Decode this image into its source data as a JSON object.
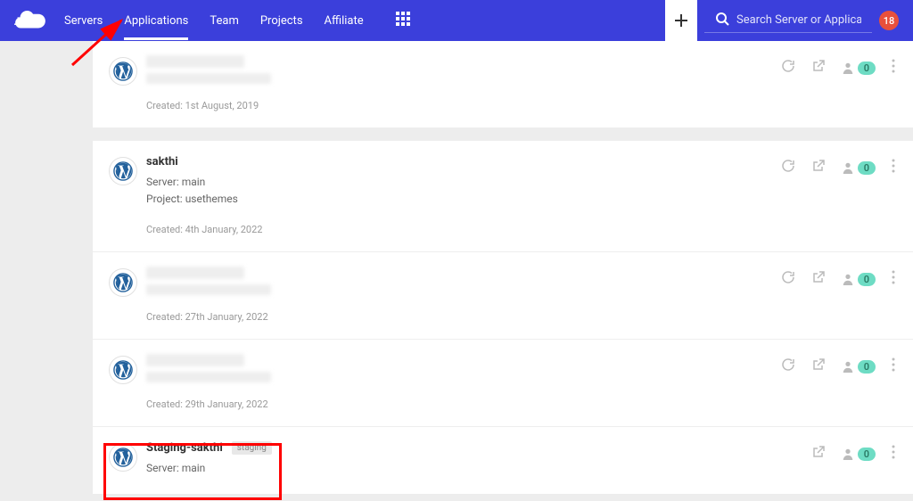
{
  "header": {
    "nav": {
      "servers": "Servers",
      "applications": "Applications",
      "team": "Team",
      "projects": "Projects",
      "affiliate": "Affiliate"
    },
    "search": {
      "placeholder": "Search Server or Application"
    },
    "notifications_count": "18"
  },
  "apps": [
    {
      "title": "",
      "blurred": true,
      "created": "Created: 1st August, 2019",
      "badge": "0"
    },
    {
      "title": "sakthi",
      "server": "Server: main",
      "project": "Project: usethemes",
      "created": "Created: 4th January, 2022",
      "badge": "0"
    },
    {
      "title": "",
      "blurred": true,
      "created": "Created: 27th January, 2022",
      "badge": "0"
    },
    {
      "title": "",
      "blurred": true,
      "created": "Created: 29th January, 2022",
      "badge": "0"
    },
    {
      "title": "Staging-sakthi",
      "tag": "staging",
      "server": "Server: main",
      "badge": "0"
    }
  ]
}
